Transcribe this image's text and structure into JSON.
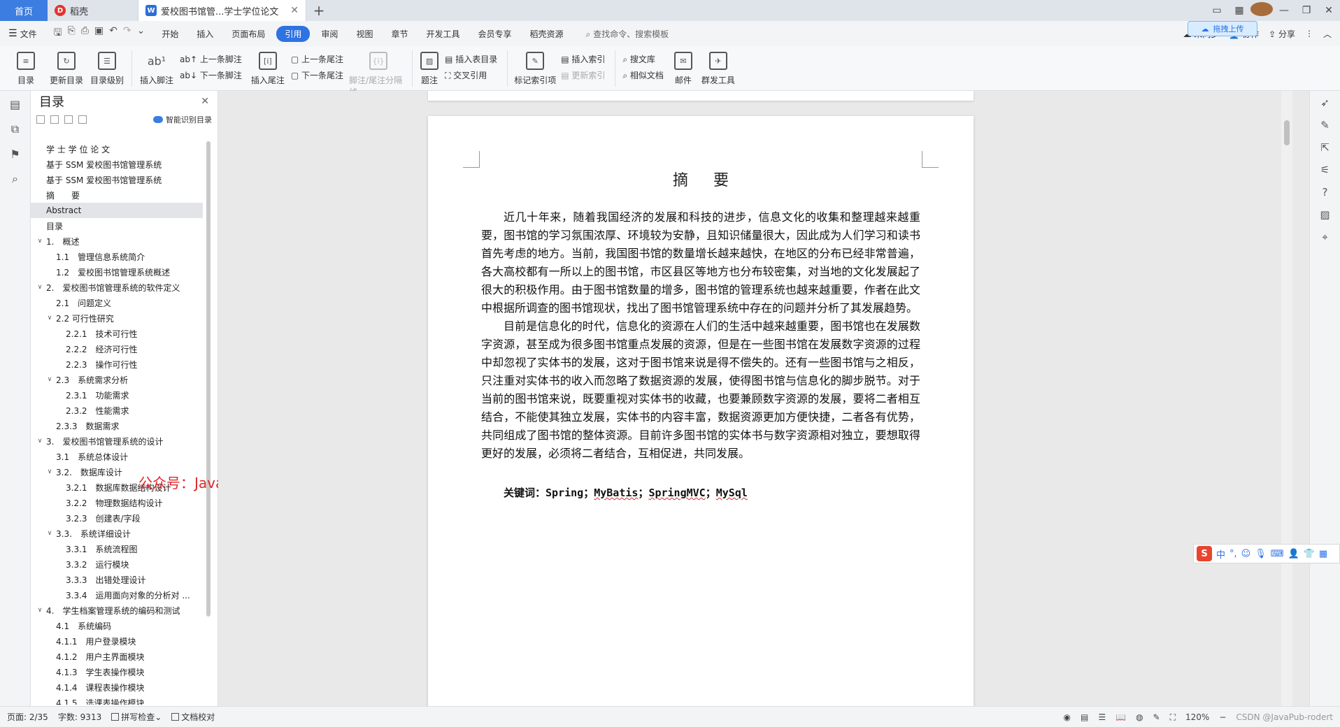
{
  "tabs": {
    "home": "首页",
    "daoke": "稻壳",
    "doc": "爱校图书馆管...学士学位论文"
  },
  "menu": {
    "file": "文件",
    "items": [
      "开始",
      "插入",
      "页面布局",
      "引用",
      "审阅",
      "视图",
      "章节",
      "开发工具",
      "会员专享",
      "稻壳资源"
    ],
    "active_index": 3,
    "search": "查找命令、搜索模板",
    "right": {
      "unsync": "未同步",
      "collab": "协作",
      "share": "分享"
    },
    "upload": "拖拽上传"
  },
  "ribbon": {
    "toc": "目录",
    "update_toc": "更新目录",
    "toc_level": "目录级别",
    "insert_footnote": "插入脚注",
    "prev_footnote": "上一条脚注",
    "next_footnote": "下一条脚注",
    "insert_endnote": "插入尾注",
    "prev_endnote": "上一条尾注",
    "next_endnote": "下一条尾注",
    "separator": "脚注/尾注分隔线",
    "caption": "题注",
    "insert_table_toc": "插入表目录",
    "cross_ref": "交叉引用",
    "mark_index": "标记索引项",
    "insert_index": "插入索引",
    "update_index": "更新索引",
    "search_lib": "搜文库",
    "similar_docs": "相似文档",
    "mail": "邮件",
    "mass_tools": "群发工具"
  },
  "toc_panel": {
    "title": "目录",
    "smart": "智能识别目录",
    "items": [
      {
        "label": "学 士 学 位 论 文",
        "level": 0,
        "arrow": ""
      },
      {
        "label": "基于 SSM 爱校图书馆管理系统",
        "level": 0,
        "arrow": ""
      },
      {
        "label": "基于 SSM 爱校图书馆管理系统",
        "level": 0,
        "arrow": ""
      },
      {
        "label": "摘　　要",
        "level": 0,
        "arrow": ""
      },
      {
        "label": "Abstract",
        "level": 0,
        "arrow": "",
        "selected": true
      },
      {
        "label": "目录",
        "level": 0,
        "arrow": ""
      },
      {
        "label": "1.　概述",
        "level": 0,
        "arrow": "v"
      },
      {
        "label": "1.1　管理信息系统简介",
        "level": 1,
        "arrow": ""
      },
      {
        "label": "1.2　爱校图书馆管理系统概述",
        "level": 1,
        "arrow": ""
      },
      {
        "label": "2.　爱校图书馆管理系统的软件定义",
        "level": 0,
        "arrow": "v"
      },
      {
        "label": "2.1　问题定义",
        "level": 1,
        "arrow": ""
      },
      {
        "label": "2.2 可行性研究",
        "level": 1,
        "arrow": "v"
      },
      {
        "label": "2.2.1　技术可行性",
        "level": 2,
        "arrow": ""
      },
      {
        "label": "2.2.2　经济可行性",
        "level": 2,
        "arrow": ""
      },
      {
        "label": "2.2.3　操作可行性",
        "level": 2,
        "arrow": ""
      },
      {
        "label": "2.3　系统需求分析",
        "level": 1,
        "arrow": "v"
      },
      {
        "label": "2.3.1　功能需求",
        "level": 2,
        "arrow": ""
      },
      {
        "label": "2.3.2　性能需求",
        "level": 2,
        "arrow": ""
      },
      {
        "label": "2.3.3　数据需求",
        "level": 1,
        "arrow": ""
      },
      {
        "label": "3.　爱校图书馆管理系统的设计",
        "level": 0,
        "arrow": "v"
      },
      {
        "label": "3.1　系统总体设计",
        "level": 1,
        "arrow": ""
      },
      {
        "label": "3.2.　数据库设计",
        "level": 1,
        "arrow": "v"
      },
      {
        "label": "3.2.1　数据库数据结构设计",
        "level": 2,
        "arrow": ""
      },
      {
        "label": "3.2.2　物理数据结构设计",
        "level": 2,
        "arrow": ""
      },
      {
        "label": "3.2.3　创建表/字段",
        "level": 2,
        "arrow": ""
      },
      {
        "label": "3.3.　系统详细设计",
        "level": 1,
        "arrow": "v"
      },
      {
        "label": "3.3.1　系统流程图",
        "level": 2,
        "arrow": ""
      },
      {
        "label": "3.3.2　运行模块",
        "level": 2,
        "arrow": ""
      },
      {
        "label": "3.3.3　出错处理设计",
        "level": 2,
        "arrow": ""
      },
      {
        "label": "3.3.4　运用面向对象的分析对 ...",
        "level": 2,
        "arrow": ""
      },
      {
        "label": "4.　学生档案管理系统的编码和测试",
        "level": 0,
        "arrow": "v"
      },
      {
        "label": "4.1　系统编码",
        "level": 1,
        "arrow": ""
      },
      {
        "label": "4.1.1　用户登录模块",
        "level": 1,
        "arrow": ""
      },
      {
        "label": "4.1.2　用户主界面模块",
        "level": 1,
        "arrow": ""
      },
      {
        "label": "4.1.3　学生表操作模块",
        "level": 1,
        "arrow": ""
      },
      {
        "label": "4.1.4　课程表操作模块",
        "level": 1,
        "arrow": ""
      },
      {
        "label": "4.1.5　选课表操作模块",
        "level": 1,
        "arrow": ""
      }
    ]
  },
  "watermark": "公众号：JavaPub",
  "document": {
    "title": "摘要",
    "para1": "近几十年来，随着我国经济的发展和科技的进步，信息文化的收集和整理越来越重要，图书馆的学习氛围浓厚、环境较为安静，且知识储量很大，因此成为人们学习和读书首先考虑的地方。当前，我国图书馆的数量增长越来越快，在地区的分布已经非常普遍，各大高校都有一所以上的图书馆，市区县区等地方也分布较密集，对当地的文化发展起了很大的积极作用。由于图书馆数量的增多，图书馆的管理系统也越来越重要，作者在此文中根据所调查的图书馆现状，找出了图书馆管理系统中存在的问题并分析了其发展趋势。",
    "para2": "目前是信息化的时代，信息化的资源在人们的生活中越来越重要，图书馆也在发展数字资源，甚至成为很多图书馆重点发展的资源，但是在一些图书馆在发展数字资源的过程中却忽视了实体书的发展，这对于图书馆来说是得不偿失的。还有一些图书馆与之相反，只注重对实体书的收入而忽略了数据资源的发展，使得图书馆与信息化的脚步脱节。对于当前的图书馆来说，既要重视对实体书的收藏，也要兼顾数字资源的发展，要将二者相互结合，不能使其独立发展，实体书的内容丰富，数据资源更加方便快捷，二者各有优势，共同组成了图书馆的整体资源。目前许多图书馆的实体书与数字资源相对独立，要想取得更好的发展，必须将二者结合，互相促进，共同发展。",
    "keywords_label": "关键词：",
    "kw1": "Spring；",
    "kw2": "MyBatis",
    "kw_sep": "；",
    "kw3": "SpringMVC",
    "kw4": "MySql"
  },
  "ime": {
    "brand": "S",
    "lang": "中"
  },
  "status": {
    "page": "页面: 2/35",
    "words": "字数: 9313",
    "spell": "拼写检查",
    "proof": "文档校对",
    "zoom": "120%",
    "csdn": "CSDN @JavaPub-rodert"
  }
}
